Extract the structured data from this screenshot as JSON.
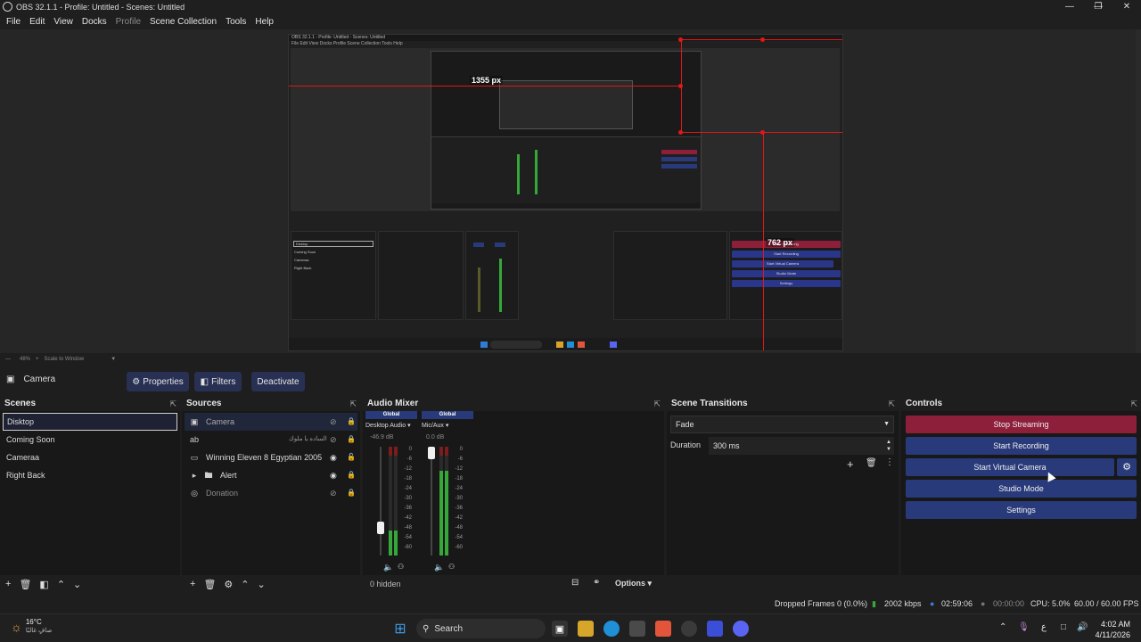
{
  "window": {
    "title": "OBS 32.1.1 - Profile: Untitled - Scenes: Untitled",
    "controls": [
      "—",
      "❐",
      "✕"
    ]
  },
  "menu": [
    "File",
    "Edit",
    "View",
    "Docks",
    "Profile",
    "Scene Collection",
    "Tools",
    "Help"
  ],
  "preview": {
    "width_label": "1355 px",
    "height_label": "762 px",
    "zoom": "48%",
    "scale_mode": "Scale to Window"
  },
  "nested": {
    "title": "OBS 32.1.1 - Profile: Untitled - Scenes: Untitled",
    "menu": "File  Edit  View  Docks  Profile  Scene Collection  Tools  Help",
    "scenes": [
      "Disktop",
      "Coming Soon",
      "Cameraa",
      "Right Back"
    ],
    "buttons": [
      "Stop Streaming",
      "Start Recording",
      "Start Virtual Camera",
      "Studio Mode",
      "Settings"
    ]
  },
  "source_toolbar": {
    "current_source": "Camera",
    "properties": "Properties",
    "filters": "Filters",
    "deactivate": "Deactivate"
  },
  "scenes": {
    "title": "Scenes",
    "items": [
      "Disktop",
      "Coming Soon",
      "Cameraa",
      "Right Back"
    ]
  },
  "sources": {
    "title": "Sources",
    "items": [
      {
        "name": "Camera",
        "icon": "camera-icon"
      },
      {
        "name": "",
        "rtl": "الساده يا ملوك",
        "icon": "text-icon"
      },
      {
        "name": "Winning Eleven 8 Egyptian 2005",
        "icon": "monitor-icon"
      },
      {
        "name": "Alert",
        "icon": "folder-icon"
      },
      {
        "name": "Donation",
        "icon": "browser-icon"
      }
    ]
  },
  "mixer": {
    "title": "Audio Mixer",
    "channels": [
      {
        "badge": "Global",
        "name": "Desktop Audio",
        "db": "-46.9 dB",
        "level": 0.5
      },
      {
        "badge": "Global",
        "name": "Mic/Aux",
        "db": "0.0 dB",
        "level": 0.95
      }
    ],
    "scale": [
      "0",
      "-6",
      "-12",
      "-18",
      "-24",
      "-30",
      "-36",
      "-42",
      "-48",
      "-54",
      "-60"
    ],
    "hidden": "0 hidden",
    "options": "Options"
  },
  "transitions": {
    "title": "Scene Transitions",
    "selected": "Fade",
    "duration_label": "Duration",
    "duration_value": "300 ms"
  },
  "controls": {
    "title": "Controls",
    "stop_streaming": "Stop Streaming",
    "start_recording": "Start Recording",
    "start_virtual_camera": "Start Virtual Camera",
    "studio_mode": "Studio Mode",
    "settings": "Settings"
  },
  "status": {
    "dropped": "Dropped Frames 0 (0.0%)",
    "bitrate": "2002 kbps",
    "stream_time": "02:59:06",
    "rec_time": "00:00:00",
    "cpu": "CPU: 5.0%",
    "fps": "60.00 / 60.00 FPS"
  },
  "taskbar": {
    "temperature": "16°C",
    "weather_text": "صافٍ غالبًا",
    "search": "Search",
    "time": "4:02 AM",
    "date": "4/11/2026",
    "lang": "ع"
  },
  "colors": {
    "accent_blue": "#283a7a",
    "stop_red": "#8e1f3a",
    "meter_green": "#36a83a"
  }
}
